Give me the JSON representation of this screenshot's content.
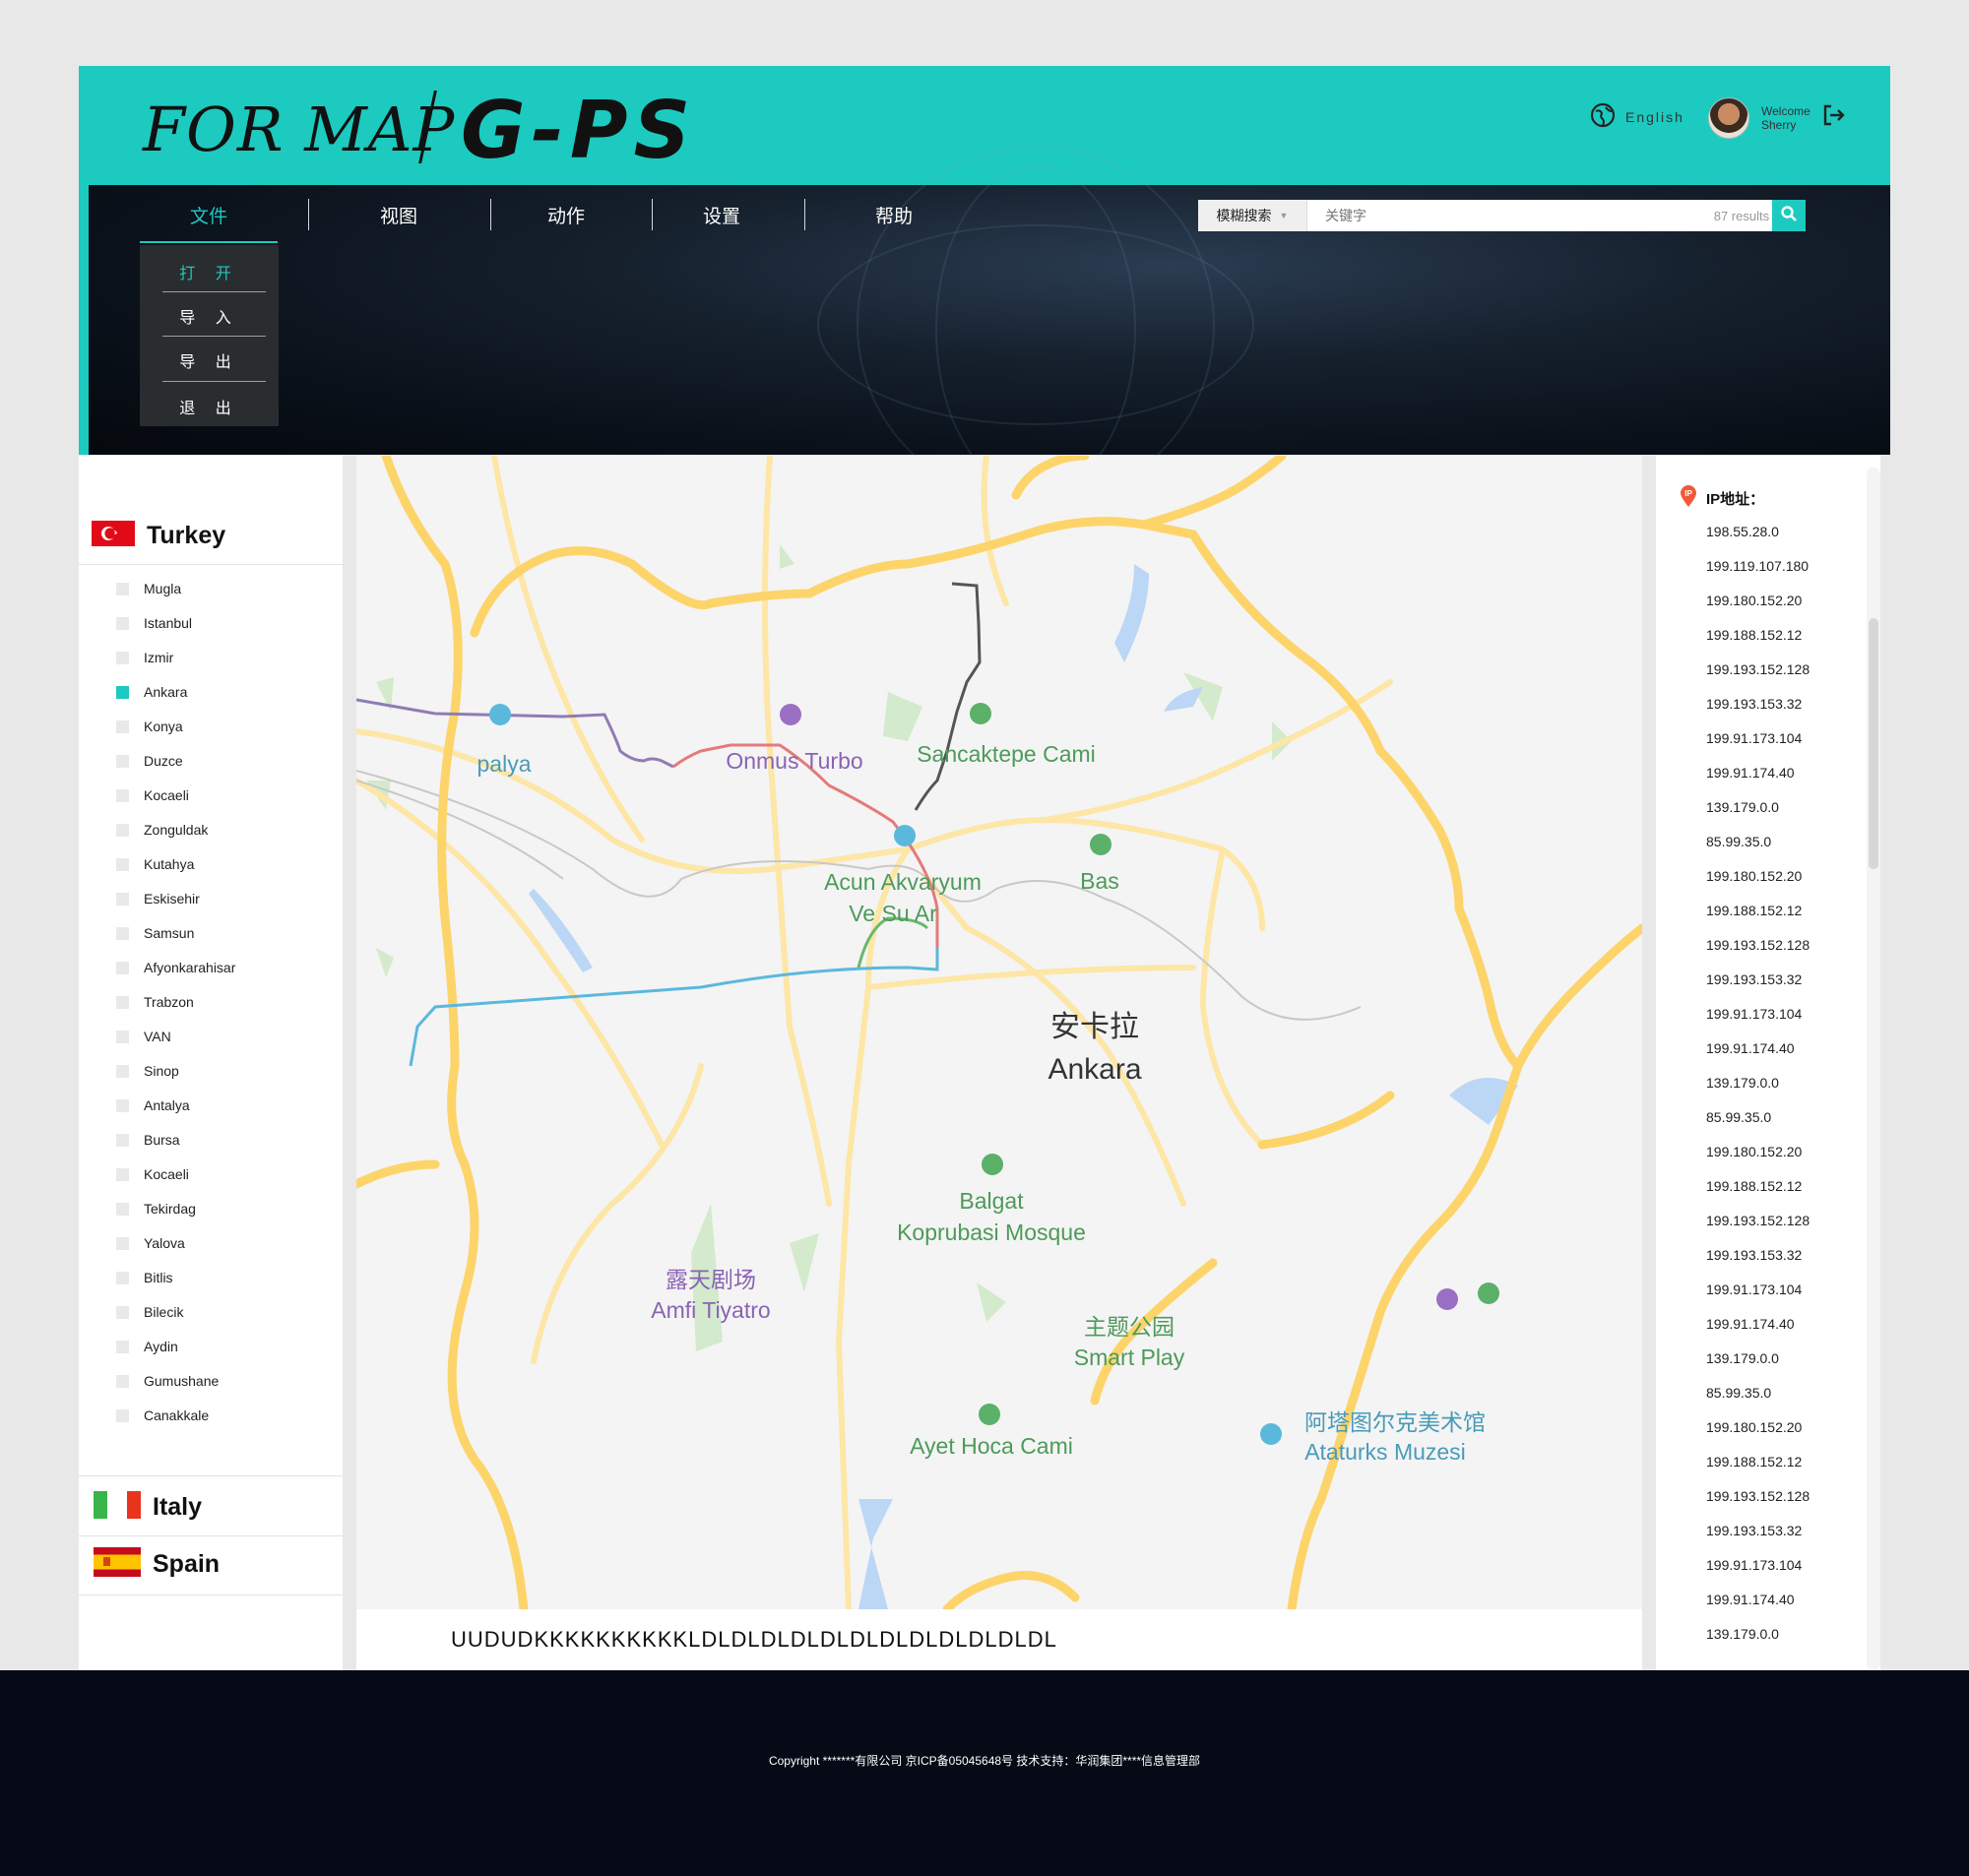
{
  "header": {
    "logo_left": "FOR MAP",
    "logo_right": "G-PS",
    "language": "English",
    "welcome": "Welcome",
    "username": "Sherry"
  },
  "nav": {
    "items": [
      "文件",
      "视图",
      "动作",
      "设置",
      "帮助"
    ],
    "active": "文件",
    "dropdown": [
      "打 开",
      "导 入",
      "导 出",
      "退 出"
    ]
  },
  "search": {
    "mode": "模糊搜索",
    "placeholder": "关键字",
    "results": "87 results"
  },
  "countries": [
    {
      "name": "Turkey",
      "cities": [
        "Mugla",
        "Istanbul",
        "Izmir",
        "Ankara",
        "Konya",
        "Duzce",
        "Kocaeli",
        "Zonguldak",
        "Kutahya",
        "Eskisehir",
        "Samsun",
        "Afyonkarahisar",
        "Trabzon",
        "VAN",
        "Sinop",
        "Antalya",
        "Bursa",
        "Kocaeli",
        "Tekirdag",
        "Yalova",
        "Bitlis",
        "Bilecik",
        "Aydin",
        "Gumushane",
        "Canakkale"
      ],
      "checked": [
        "Ankara"
      ]
    },
    {
      "name": "Italy"
    },
    {
      "name": "Spain"
    }
  ],
  "map": {
    "labels": {
      "palya": "palya",
      "onmus": "Onmus Turbo",
      "sancaktepe": "Sancaktepe Cami",
      "acun1": "Acun Akvaryum",
      "acun2": "Ve Su Ar",
      "bas": "Bas",
      "ankara_cn": "安卡拉",
      "ankara": "Ankara",
      "balgat1": "Balgat",
      "balgat2": "Koprubasi Mosque",
      "amfi_cn": "露天剧场",
      "amfi": "Amfi Tiyatro",
      "smart_cn": "主题公园",
      "smart": "Smart Play",
      "ayet": "Ayet Hoca Cami",
      "ataturk_cn": "阿塔图尔克美术馆",
      "ataturk": "Ataturks Muzesi"
    },
    "route_code": "UUDUDKKKKKKKKKKLDLDLDLDLDLDLDLDLDLDLDLDL"
  },
  "ip_panel": {
    "title": "IP地址：",
    "addresses": [
      "198.55.28.0",
      "199.119.107.180",
      "199.180.152.20",
      "199.188.152.12",
      "199.193.152.128",
      "199.193.153.32",
      "199.91.173.104",
      "199.91.174.40",
      "139.179.0.0",
      "85.99.35.0",
      "199.180.152.20",
      "199.188.152.12",
      "199.193.152.128",
      "199.193.153.32",
      "199.91.173.104",
      "199.91.174.40",
      "139.179.0.0",
      "85.99.35.0",
      "199.180.152.20",
      "199.188.152.12",
      "199.193.152.128",
      "199.193.153.32",
      "199.91.173.104",
      "199.91.174.40",
      "139.179.0.0",
      "85.99.35.0",
      "199.180.152.20",
      "199.188.152.12",
      "199.193.152.128",
      "199.193.153.32",
      "199.91.173.104",
      "199.91.174.40",
      "139.179.0.0",
      "85.99.35.0"
    ]
  },
  "footer": {
    "copyright": "Copyright *******有限公司 京ICP备05045648号 技术支持：华润集团****信息管理部"
  },
  "colors": {
    "accent": "#1ccac0",
    "footer": "#050a16",
    "road_major": "#fdd46a",
    "road_minor": "#fde6a6"
  }
}
